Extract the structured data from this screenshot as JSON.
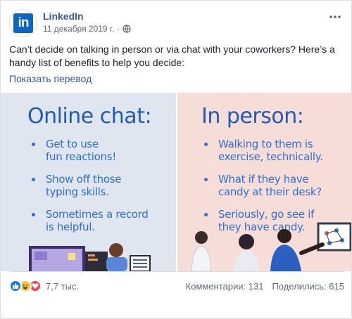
{
  "post": {
    "page_name": "LinkedIn",
    "avatar_text": "in",
    "date": "11 декабря 2019 г.",
    "separator": "·",
    "text": "Can’t decide on talking in person or via chat with your coworkers? Here’s a handy list of benefits to help you decide:",
    "translate_link": "Показать перевод"
  },
  "image": {
    "left_title": "Online chat:",
    "left_items": [
      [
        "Get to use",
        "fun reactions!"
      ],
      [
        "Show off those",
        "typing skills."
      ],
      [
        "Sometimes a record",
        "is helpful."
      ]
    ],
    "right_title": "In person:",
    "right_items": [
      [
        "Walking to them is",
        "exercise, technically."
      ],
      [
        "What if they have",
        "candy at their desk?"
      ],
      [
        "Seriously, go see if",
        "they have candy."
      ]
    ]
  },
  "footer": {
    "reaction_count": "7,7 тыс.",
    "comments": "Комментарии: 131",
    "shares": "Поделились: 615"
  },
  "colors": {
    "link": "#385898",
    "brand": "#0a66c2",
    "infographic_blue": "#2059b8",
    "left_bg": "#dfe6ef",
    "right_bg": "#f7ddd7"
  },
  "icons": [
    "globe-icon",
    "more-options-icon",
    "like-reaction-icon",
    "haha-reaction-icon",
    "love-reaction-icon"
  ]
}
